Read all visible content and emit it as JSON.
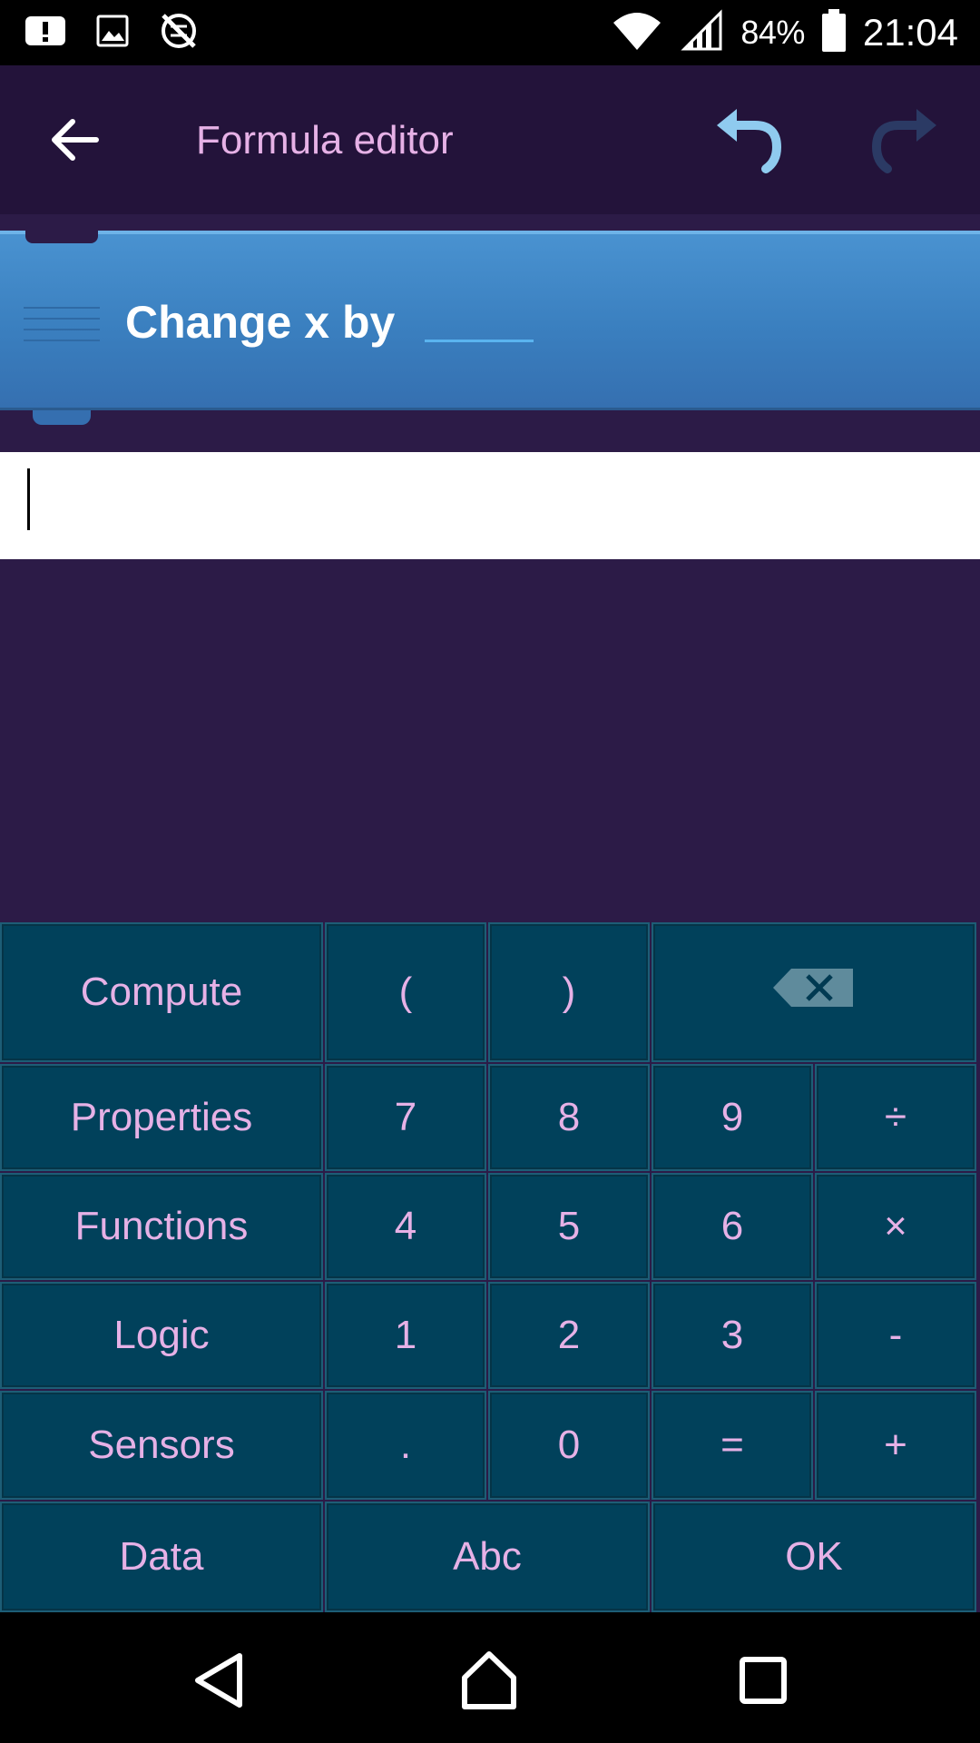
{
  "status_bar": {
    "battery_percent": "84%",
    "time": "21:04",
    "icons": [
      "alert-icon",
      "image-icon",
      "no-sync-icon",
      "wifi-icon",
      "signal-icon",
      "battery-icon"
    ]
  },
  "app_bar": {
    "title": "Formula editor",
    "back_icon": "arrow-back-icon",
    "undo_icon": "undo-icon",
    "redo_icon": "redo-icon"
  },
  "brick": {
    "label": "Change x by",
    "value": ""
  },
  "formula": {
    "text": ""
  },
  "keypad": {
    "compute": "Compute",
    "open_paren": "(",
    "close_paren": ")",
    "backspace_icon": "backspace-icon",
    "properties": "Properties",
    "functions": "Functions",
    "logic": "Logic",
    "sensors": "Sensors",
    "data": "Data",
    "abc": "Abc",
    "ok": "OK",
    "digits": [
      "7",
      "8",
      "9",
      "4",
      "5",
      "6",
      "1",
      "2",
      "3",
      ".",
      "0"
    ],
    "divide": "÷",
    "multiply": "×",
    "minus": "-",
    "equals": "=",
    "plus": "+"
  },
  "colors": {
    "background": "#2c1b47",
    "app_bar": "#23133a",
    "brick": "#3d86c6",
    "key_background": "#01415b",
    "key_text": "#e6b1e6"
  }
}
